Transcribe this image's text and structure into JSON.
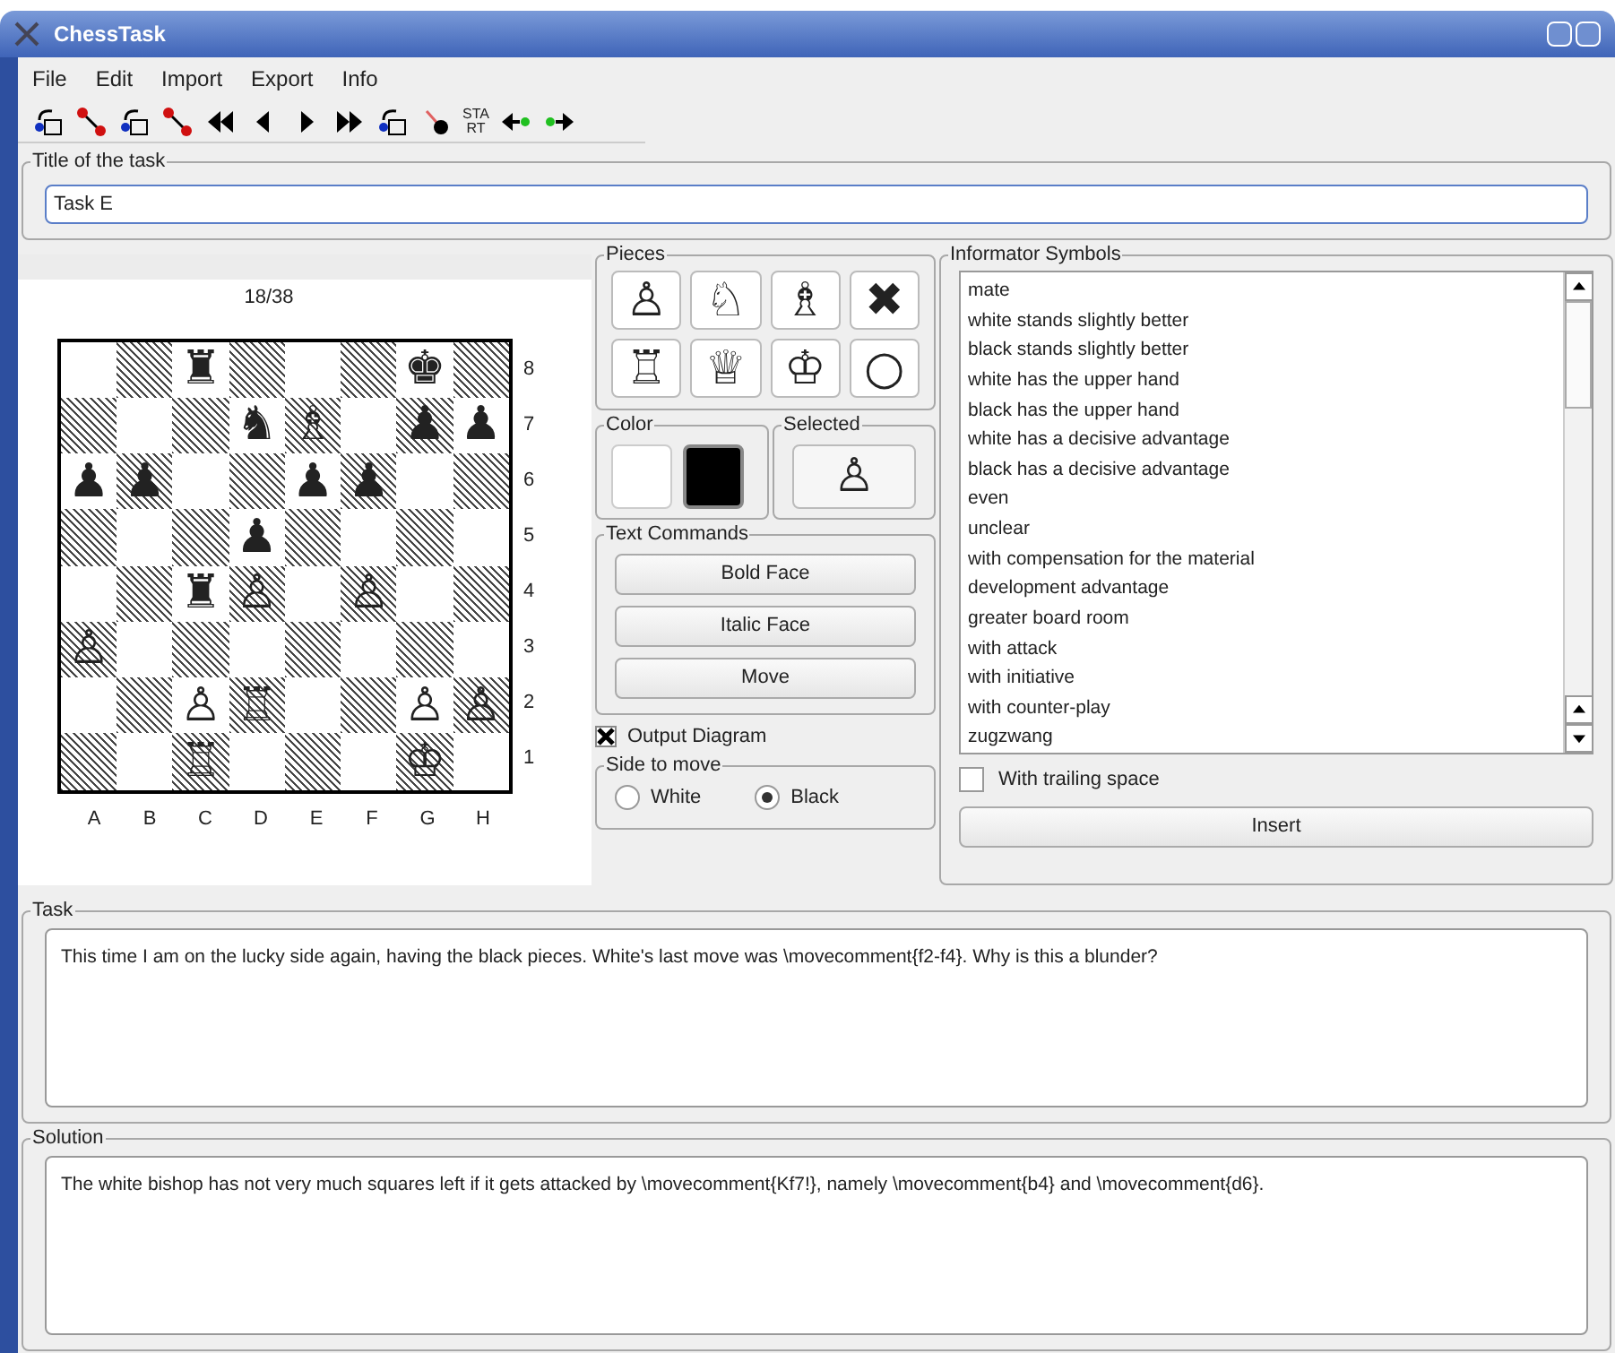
{
  "window": {
    "title": "ChessTask"
  },
  "menu": [
    "File",
    "Edit",
    "Import",
    "Export",
    "Info"
  ],
  "toolbar": {
    "start_label": [
      "STA",
      "RT"
    ]
  },
  "task_title": {
    "label": "Title of the task",
    "value": "Task E"
  },
  "board": {
    "counter": "18/38",
    "files": [
      "A",
      "B",
      "C",
      "D",
      "E",
      "F",
      "G",
      "H"
    ],
    "ranks": [
      "8",
      "7",
      "6",
      "5",
      "4",
      "3",
      "2",
      "1"
    ],
    "rows": [
      [
        {
          "kind": "empty"
        },
        {
          "kind": "empty"
        },
        {
          "kind": "piece",
          "glyph": "♜"
        },
        {
          "kind": "empty"
        },
        {
          "kind": "empty"
        },
        {
          "kind": "empty"
        },
        {
          "kind": "piece",
          "glyph": "♚"
        },
        {
          "kind": "empty"
        }
      ],
      [
        {
          "kind": "empty"
        },
        {
          "kind": "empty"
        },
        {
          "kind": "empty"
        },
        {
          "kind": "piece",
          "glyph": "♞"
        },
        {
          "kind": "piece",
          "glyph": "♗"
        },
        {
          "kind": "empty"
        },
        {
          "kind": "piece",
          "glyph": "♟"
        },
        {
          "kind": "piece",
          "glyph": "♟"
        }
      ],
      [
        {
          "kind": "piece",
          "glyph": "♟"
        },
        {
          "kind": "piece",
          "glyph": "♟"
        },
        {
          "kind": "empty"
        },
        {
          "kind": "empty"
        },
        {
          "kind": "piece",
          "glyph": "♟"
        },
        {
          "kind": "piece",
          "glyph": "♟"
        },
        {
          "kind": "empty"
        },
        {
          "kind": "empty"
        }
      ],
      [
        {
          "kind": "empty"
        },
        {
          "kind": "empty"
        },
        {
          "kind": "empty"
        },
        {
          "kind": "piece",
          "glyph": "♟"
        },
        {
          "kind": "empty"
        },
        {
          "kind": "empty"
        },
        {
          "kind": "empty"
        },
        {
          "kind": "empty"
        }
      ],
      [
        {
          "kind": "empty"
        },
        {
          "kind": "empty"
        },
        {
          "kind": "piece",
          "glyph": "♜"
        },
        {
          "kind": "piece",
          "glyph": "♙"
        },
        {
          "kind": "empty"
        },
        {
          "kind": "piece",
          "glyph": "♙"
        },
        {
          "kind": "empty"
        },
        {
          "kind": "empty"
        }
      ],
      [
        {
          "kind": "piece",
          "glyph": "♙"
        },
        {
          "kind": "empty"
        },
        {
          "kind": "empty"
        },
        {
          "kind": "empty"
        },
        {
          "kind": "empty"
        },
        {
          "kind": "empty"
        },
        {
          "kind": "empty"
        },
        {
          "kind": "empty"
        }
      ],
      [
        {
          "kind": "empty"
        },
        {
          "kind": "empty"
        },
        {
          "kind": "piece",
          "glyph": "♙"
        },
        {
          "kind": "piece",
          "glyph": "♖"
        },
        {
          "kind": "empty"
        },
        {
          "kind": "empty"
        },
        {
          "kind": "piece",
          "glyph": "♙"
        },
        {
          "kind": "piece",
          "glyph": "♙"
        }
      ],
      [
        {
          "kind": "empty"
        },
        {
          "kind": "empty"
        },
        {
          "kind": "piece",
          "glyph": "♖"
        },
        {
          "kind": "empty"
        },
        {
          "kind": "empty"
        },
        {
          "kind": "empty"
        },
        {
          "kind": "piece",
          "glyph": "♔"
        },
        {
          "kind": "empty"
        }
      ]
    ]
  },
  "pieces": {
    "label": "Pieces",
    "items": [
      "♙",
      "♘",
      "♗",
      "✖",
      "♖",
      "♕",
      "♔",
      "○"
    ]
  },
  "color": {
    "label": "Color",
    "options": [
      {
        "kind": "white",
        "selected": false
      },
      {
        "kind": "black",
        "selected": true
      }
    ]
  },
  "selected": {
    "label": "Selected",
    "piece": "♙"
  },
  "text_commands": {
    "label": "Text Commands",
    "buttons": [
      "Bold Face",
      "Italic Face",
      "Move"
    ]
  },
  "output_diagram": {
    "label": "Output Diagram",
    "checked": true
  },
  "side_to_move": {
    "label": "Side to move",
    "options": [
      {
        "label": "White",
        "selected": false
      },
      {
        "label": "Black",
        "selected": true
      }
    ]
  },
  "informator": {
    "label": "Informator Symbols",
    "items": [
      "mate",
      "white stands slightly better",
      "black stands slightly better",
      "white has the upper hand",
      "black has the upper hand",
      "white has a decisive advantage",
      "black has a decisive advantage",
      "even",
      "unclear",
      "with compensation for the material",
      "development advantage",
      "greater board room",
      "with attack",
      "with initiative",
      "with counter-play",
      "zugzwang"
    ],
    "trailing_space": {
      "label": "With trailing space",
      "checked": false
    },
    "insert": "Insert"
  },
  "task": {
    "label": "Task",
    "text": "This time I am on the lucky side again, having the black pieces. White's last move was \\movecomment{f2-f4}. Why is this a blunder?"
  },
  "solution": {
    "label": "Solution",
    "text": "The white bishop has not very much squares left if it gets attacked by \\movecomment{Kf7!}, namely \\movecomment{b4} and \\movecomment{d6}."
  }
}
